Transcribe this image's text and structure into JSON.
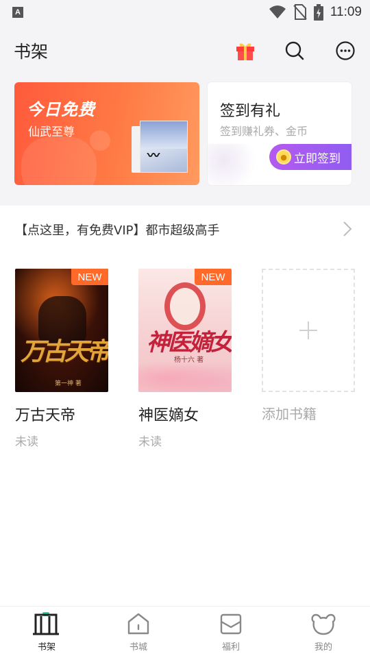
{
  "status_bar": {
    "time": "11:09",
    "left_icon_letter": "A",
    "icons": [
      "notification-a-icon",
      "wifi-icon",
      "no-sim-icon",
      "battery-charging-icon"
    ]
  },
  "header": {
    "title": "书架",
    "actions": [
      "gift-icon",
      "search-icon",
      "more-icon"
    ]
  },
  "banner": {
    "free_today": {
      "title": "今日免费",
      "book_name": "仙武至尊"
    },
    "sign_in": {
      "title": "签到有礼",
      "subtitle": "签到赚礼券、金币",
      "button_label": "立即签到",
      "accent_color": "#9a5cf0"
    }
  },
  "notice": {
    "text": "【点这里，有免费VIP】都市超级高手"
  },
  "shelf": {
    "books": [
      {
        "title": "万古天帝",
        "status": "未读",
        "badge": "NEW",
        "cover_title": "万古天帝",
        "cover_author": "第一神 著"
      },
      {
        "title": "神医嫡女",
        "status": "未读",
        "badge": "NEW",
        "cover_title": "神医嫡女",
        "cover_author": "杨十六 著"
      }
    ],
    "add_label": "添加书籍"
  },
  "tabbar": {
    "tabs": [
      {
        "label": "书架",
        "icon": "bookshelf-icon",
        "active": true
      },
      {
        "label": "书城",
        "icon": "home-icon",
        "active": false
      },
      {
        "label": "福利",
        "icon": "mail-icon",
        "active": false
      },
      {
        "label": "我的",
        "icon": "bear-face-icon",
        "active": false
      }
    ]
  },
  "colors": {
    "badge": "#ff6a2a",
    "free_card": "#ff6a45",
    "tab_active_accent": "#3ec99a"
  }
}
